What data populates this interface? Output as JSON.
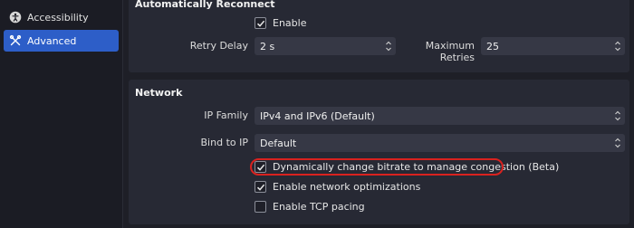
{
  "sidebar": {
    "items": [
      {
        "label": "Accessibility",
        "icon": "accessibility-icon",
        "active": false
      },
      {
        "label": "Advanced",
        "icon": "wrench-icon",
        "active": true
      }
    ]
  },
  "reconnect": {
    "title": "Automatically Reconnect",
    "enable_label": "Enable",
    "enable_checked": true,
    "retry_delay_label": "Retry Delay",
    "retry_delay_value": "2 s",
    "max_retries_label": "Maximum Retries",
    "max_retries_value": "25"
  },
  "network": {
    "title": "Network",
    "ip_family_label": "IP Family",
    "ip_family_value": "IPv4 and IPv6 (Default)",
    "bind_ip_label": "Bind to IP",
    "bind_ip_value": "Default",
    "options": [
      {
        "label": "Dynamically change bitrate to manage congestion (Beta)",
        "checked": true
      },
      {
        "label": "Enable network optimizations",
        "checked": true
      },
      {
        "label": "Enable TCP pacing",
        "checked": false
      }
    ]
  },
  "colors": {
    "accent": "#2d5ec8",
    "highlight": "#d9221f",
    "panel": "#272934",
    "field": "#363845"
  }
}
